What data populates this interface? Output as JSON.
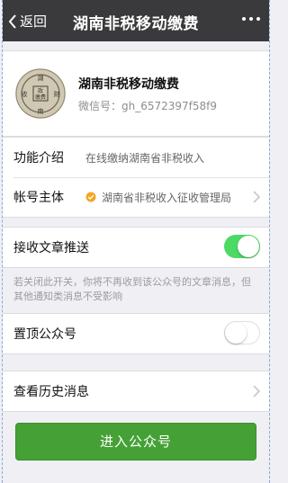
{
  "nav": {
    "back_label": "返回",
    "title": "湖南非税移动缴费",
    "more_icon": "more-dots-icon"
  },
  "profile": {
    "name": "湖南非税移动缴费",
    "wechat_id": "微信号：gh_6572397f58f9",
    "avatar_chars": [
      "湖",
      "南",
      "收",
      "财",
      "政",
      "缴",
      "费"
    ]
  },
  "info": {
    "intro_label": "功能介绍",
    "intro_value": "在线缴纳湖南省非税收入",
    "account_label": "帐号主体",
    "account_value": "湖南省非税收入征收管理局"
  },
  "receive": {
    "label": "接收文章推送",
    "enabled": true,
    "note": "若关闭此开关，你将不再收到该公众号的文章消息，但其他通知类消息不受影响"
  },
  "pin": {
    "label": "置顶公众号",
    "enabled": false
  },
  "history": {
    "label": "查看历史消息"
  },
  "enter_button": "进入公众号",
  "colors": {
    "nav_bg": "#3a3a3c",
    "toggle_on": "#4cd964",
    "button_green": "#45a136",
    "verified": "#f5a623"
  }
}
